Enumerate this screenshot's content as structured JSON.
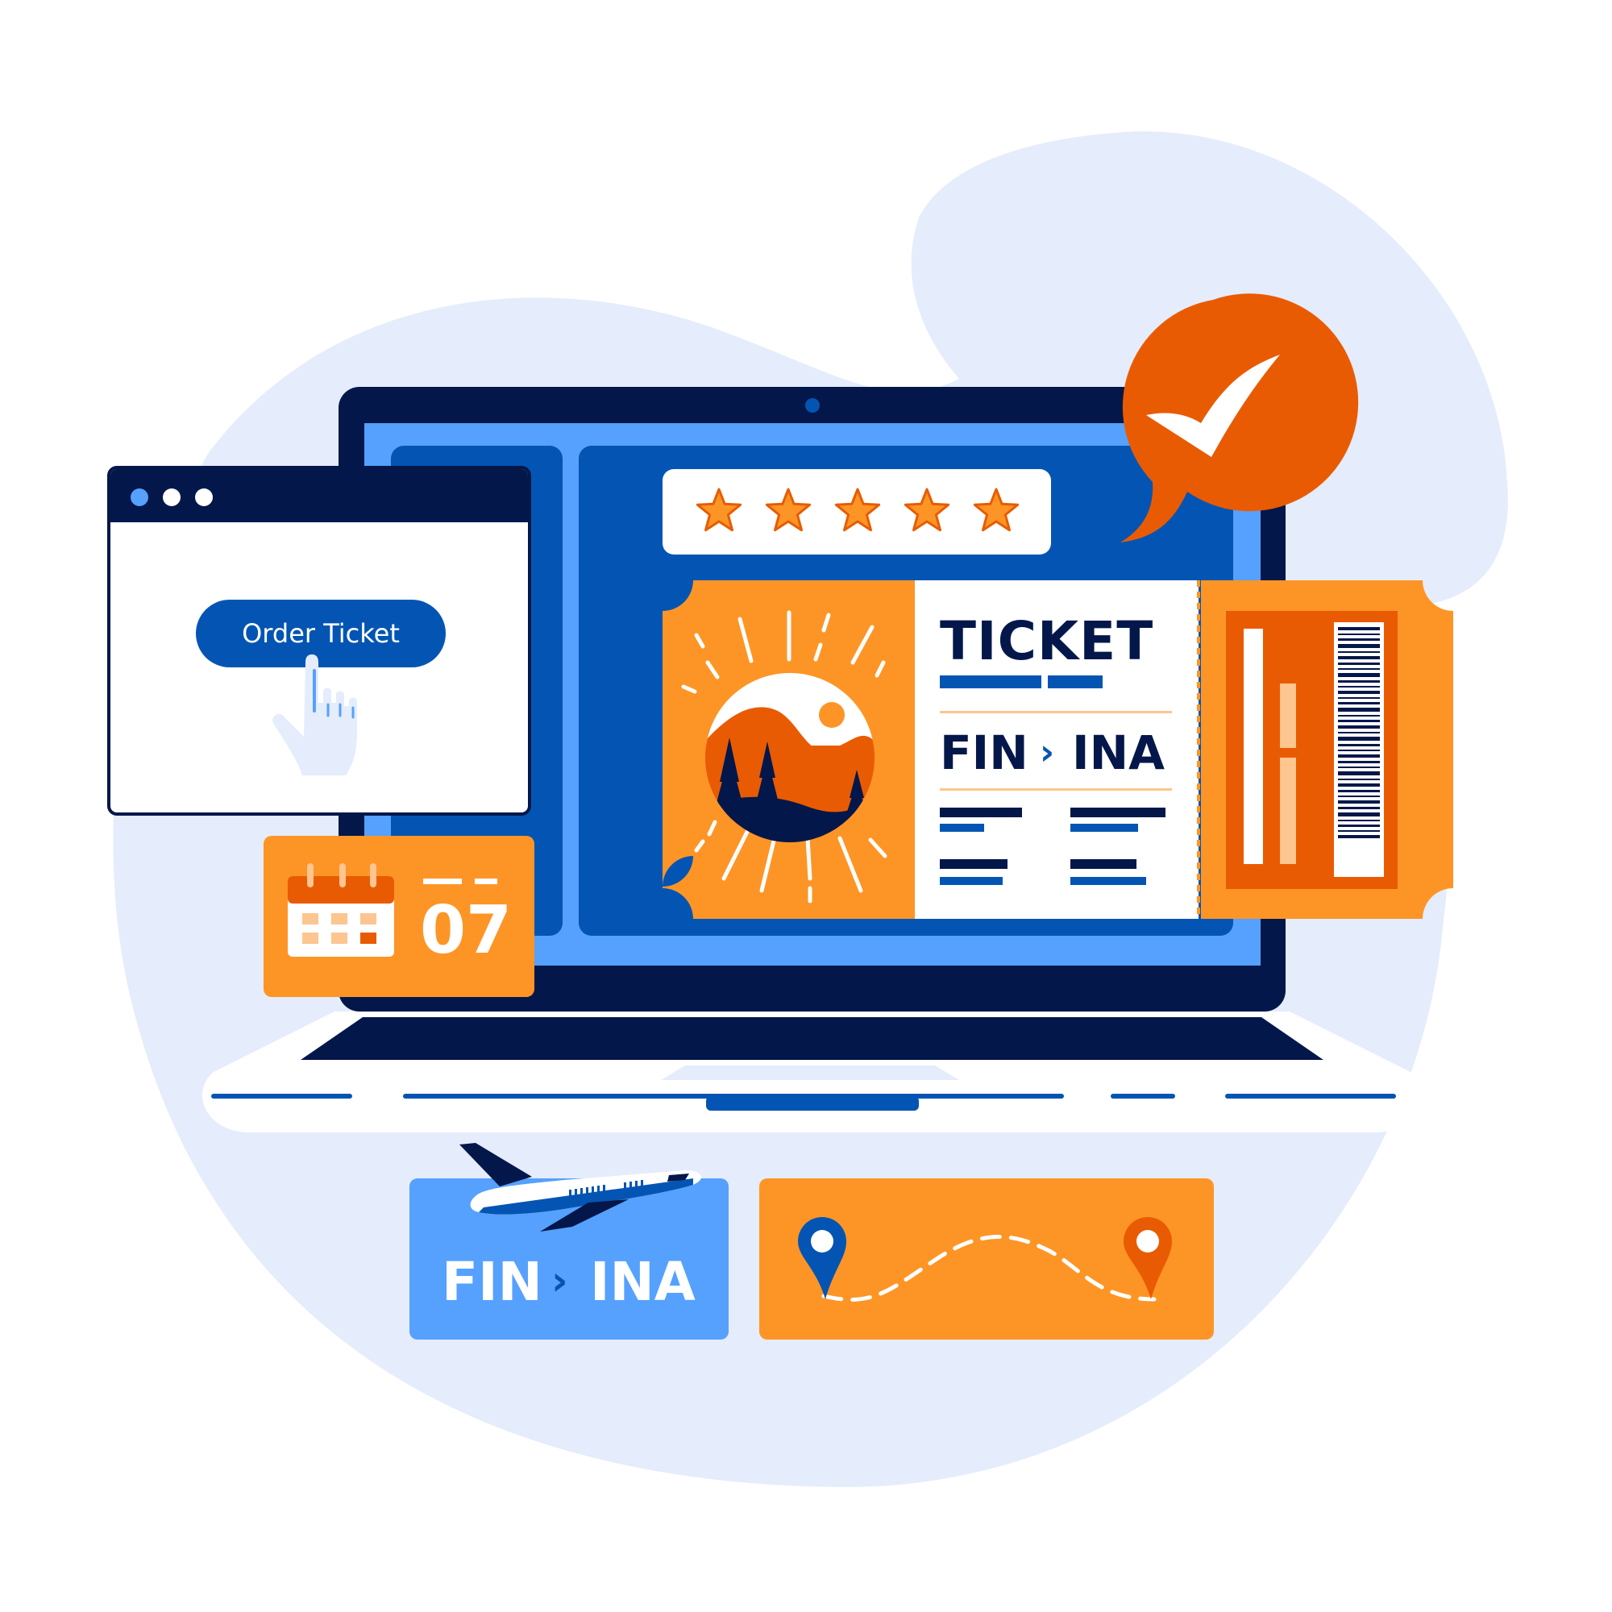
{
  "colors": {
    "navy": "#03174A",
    "blue": "#0455B3",
    "light_blue": "#55A1FD",
    "orange": "#FD9526",
    "dark_orange": "#E95B02",
    "blob": "#E5ECFB",
    "white": "#FFFFFF",
    "peach": "#FDC590"
  },
  "browser_window": {
    "order_button_label": "Order Ticket"
  },
  "calendar_card": {
    "date": "07"
  },
  "rating": {
    "stars": 5,
    "max": 5
  },
  "ticket": {
    "title": "TICKET",
    "from": "FIN",
    "to": "INA"
  },
  "route_card": {
    "from": "FIN",
    "to": "INA"
  },
  "icons": {
    "confirm": "checkmark-icon",
    "plane": "airplane-icon",
    "hand": "pointer-hand-icon",
    "calendar": "calendar-icon"
  }
}
